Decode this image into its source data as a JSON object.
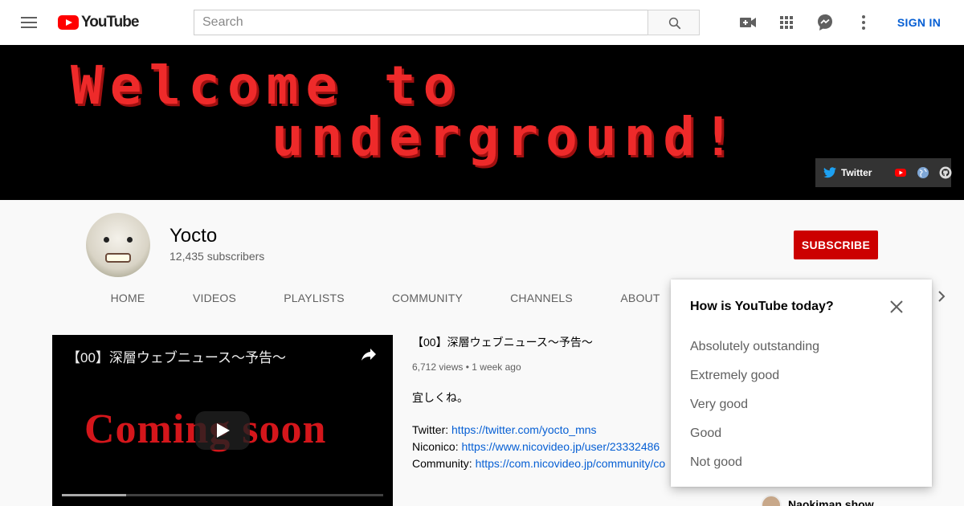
{
  "masthead": {
    "logo_text": "YouTube",
    "search_placeholder": "Search",
    "signin_label": "SIGN IN"
  },
  "banner": {
    "line1": "Welcome to",
    "line2": "underground!",
    "twitter_label": "Twitter"
  },
  "channel": {
    "name": "Yocto",
    "subscribers": "12,435 subscribers",
    "subscribe_label": "SUBSCRIBE",
    "tabs": [
      {
        "label": "HOME",
        "active": true
      },
      {
        "label": "VIDEOS",
        "active": false
      },
      {
        "label": "PLAYLISTS",
        "active": false
      },
      {
        "label": "COMMUNITY",
        "active": false
      },
      {
        "label": "CHANNELS",
        "active": false
      },
      {
        "label": "ABOUT",
        "active": false
      }
    ]
  },
  "featured_video": {
    "player_title": "【00】深層ウェブニュース～予告～",
    "thumbnail_text": "Coming soon",
    "progress": 0.2,
    "title": "【00】深層ウェブニュース～予告～",
    "views": "6,712 views",
    "age": "1 week ago",
    "description": "宜しくね。",
    "links": [
      {
        "label": "Twitter: ",
        "url": "https://twitter.com/yocto_mns"
      },
      {
        "label": "Niconico: ",
        "url": "https://www.nicovideo.jp/user/23332486"
      },
      {
        "label": "Community: ",
        "url": "https://com.nicovideo.jp/community/co"
      }
    ]
  },
  "featured_channel": {
    "name": "Naokiman show"
  },
  "survey": {
    "title": "How is YouTube today?",
    "options": [
      "Absolutely outstanding",
      "Extremely good",
      "Very good",
      "Good",
      "Not good"
    ]
  },
  "colors": {
    "brand_red": "#ff0000",
    "subscribe_red": "#cc0000",
    "link_blue": "#065fd4",
    "banner_text_red": "#ee2a2a"
  }
}
